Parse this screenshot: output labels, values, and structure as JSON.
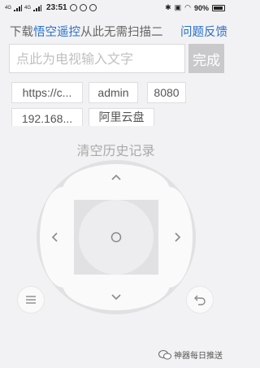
{
  "status_bar": {
    "signal_1": "4G",
    "signal_2": "4G",
    "time": "23:51",
    "battery": "90%"
  },
  "header": {
    "prefix": "下载",
    "app_link": "悟空遥控",
    "suffix": "从此无需扫描二",
    "feedback": "问题反馈"
  },
  "input": {
    "placeholder": "点此为电视输入文字",
    "value": ""
  },
  "done_button": "完成",
  "history": {
    "items": [
      "https://c...",
      "admin",
      "8080",
      "192.168...",
      "阿里云盘"
    ],
    "clear_label": "清空历史记录"
  },
  "icons": {
    "up": "chevron-up",
    "down": "chevron-down",
    "left": "chevron-left",
    "right": "chevron-right",
    "ok": "circle-ok",
    "menu": "hamburger-menu",
    "back": "back-arrow"
  },
  "watermark": {
    "text": "神器每日推送"
  },
  "colors": {
    "background": "#f2f2f4",
    "link": "#2b6fc9",
    "done_button": "#c9c9cc",
    "pad_ring": "#e1e1e4",
    "pad_button": "#fafafa"
  }
}
